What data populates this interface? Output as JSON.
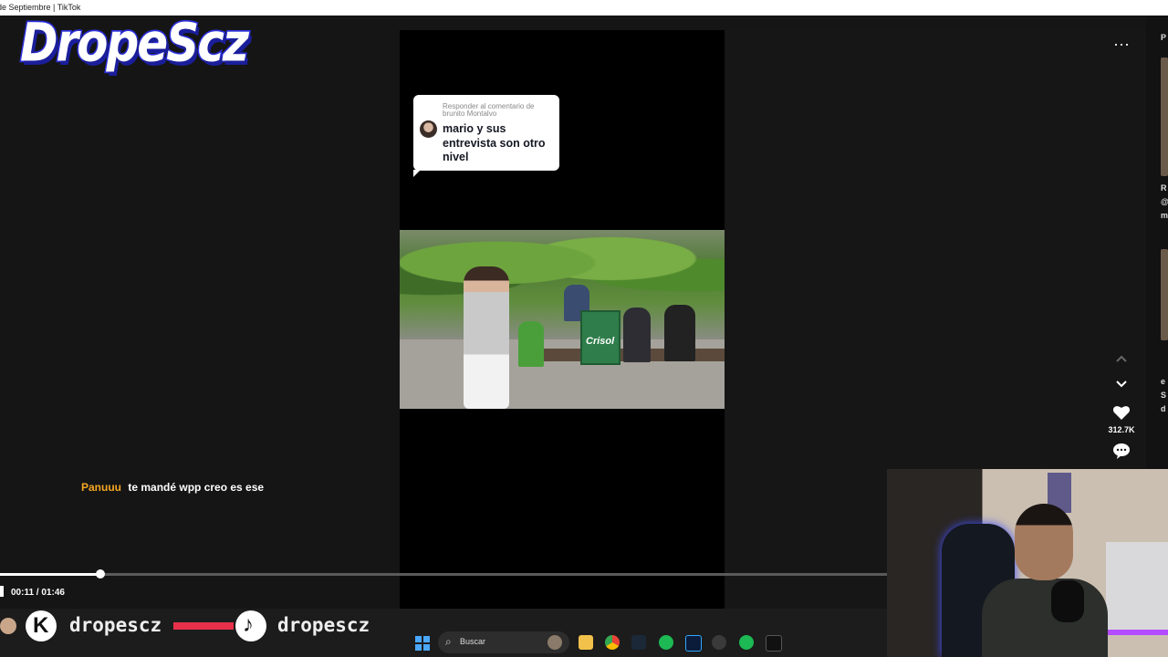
{
  "window": {
    "title": "de Septiembre | TikTok"
  },
  "overlay": {
    "logo_text": "DropeScz"
  },
  "reply_card": {
    "header": "Responder al comentario de brunito Montalvo",
    "text": "mario y sus entrevista son otro nivel"
  },
  "video_scene": {
    "sign_text": "Crisol"
  },
  "chat": {
    "username": "Panuuu",
    "message": "te mandé wpp creo es ese"
  },
  "actions": {
    "more_icon": "more-horizontal-icon",
    "like_count": "312.7K",
    "comment_icon": "comment-icon"
  },
  "player": {
    "time": "00:11 / 01:46",
    "progress": 0.113
  },
  "branding": {
    "kick_name": "dropescz",
    "tiktok_name": "dropescz"
  },
  "taskbar": {
    "search_placeholder": "Buscar"
  },
  "right_rail": {
    "letters": [
      "P",
      "R",
      "@",
      "m",
      "e",
      "S",
      "d"
    ]
  }
}
